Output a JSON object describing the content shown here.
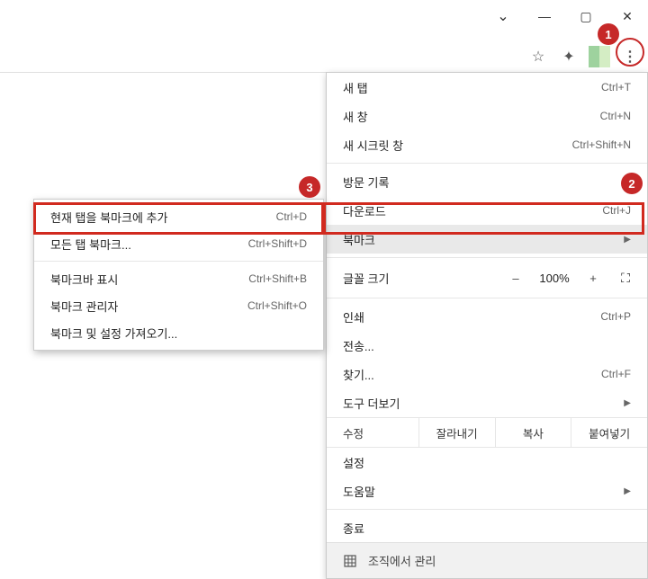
{
  "window": {
    "chevron": "⌄",
    "minimize": "—",
    "maximize": "▢",
    "close": "✕"
  },
  "toolbar": {
    "star": "☆",
    "puzzle": "✦",
    "kebab": "⋮"
  },
  "menu": {
    "new_tab": {
      "label": "새 탭",
      "shortcut": "Ctrl+T"
    },
    "new_window": {
      "label": "새 창",
      "shortcut": "Ctrl+N"
    },
    "incognito": {
      "label": "새 시크릿 창",
      "shortcut": "Ctrl+Shift+N"
    },
    "history": {
      "label": "방문 기록",
      "arrow": "▶"
    },
    "downloads": {
      "label": "다운로드",
      "shortcut": "Ctrl+J"
    },
    "bookmarks": {
      "label": "북마크",
      "arrow": "▶"
    },
    "zoom": {
      "label": "글꼴 크기",
      "minus": "–",
      "value": "100%",
      "plus": "+",
      "full": "⛶"
    },
    "print": {
      "label": "인쇄",
      "shortcut": "Ctrl+P"
    },
    "cast": {
      "label": "전송..."
    },
    "find": {
      "label": "찾기...",
      "shortcut": "Ctrl+F"
    },
    "more_tools": {
      "label": "도구 더보기",
      "arrow": "▶"
    },
    "edit": {
      "label": "수정",
      "cut": "잘라내기",
      "copy": "복사",
      "paste": "붙여넣기"
    },
    "settings": {
      "label": "설정"
    },
    "help": {
      "label": "도움말",
      "arrow": "▶"
    },
    "exit": {
      "label": "종료"
    },
    "managed": {
      "label": "조직에서 관리"
    }
  },
  "submenu": {
    "add_bookmark": {
      "label": "현재 탭을 북마크에 추가",
      "shortcut": "Ctrl+D"
    },
    "bookmark_all": {
      "label": "모든 탭 북마크...",
      "shortcut": "Ctrl+Shift+D"
    },
    "show_bar": {
      "label": "북마크바 표시",
      "shortcut": "Ctrl+Shift+B"
    },
    "manager": {
      "label": "북마크 관리자",
      "shortcut": "Ctrl+Shift+O"
    },
    "import": {
      "label": "북마크 및 설정 가져오기..."
    }
  },
  "badges": {
    "b1": "1",
    "b2": "2",
    "b3": "3"
  }
}
